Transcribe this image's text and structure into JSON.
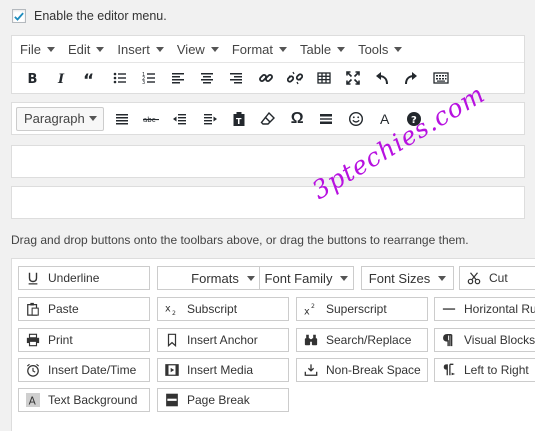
{
  "settings": {
    "enable_menu_label": "Enable the editor menu.",
    "enable_menu_checked": true
  },
  "menubar": {
    "items": [
      "File",
      "Edit",
      "Insert",
      "View",
      "Format",
      "Table",
      "Tools"
    ]
  },
  "toolbar1": {
    "icons": [
      "bold-icon",
      "italic-icon",
      "blockquote-icon",
      "bulleted-list-icon",
      "numbered-list-icon",
      "align-left-icon",
      "align-center-icon",
      "align-right-icon",
      "link-icon",
      "unlink-icon",
      "table-icon",
      "fullscreen-icon",
      "undo-icon",
      "redo-icon",
      "toolbar-toggle-icon"
    ]
  },
  "toolbar2": {
    "format_select": "Paragraph",
    "icons": [
      "justify-icon",
      "strikethrough-icon",
      "outdent-icon",
      "indent-icon",
      "paste-as-text-icon",
      "clear-formatting-icon",
      "special-character-icon",
      "horizontal-line-icon",
      "emoticons-icon",
      "text-color-icon",
      "help-icon"
    ],
    "text_color_glyph": "A",
    "special_char_glyph": "Ω"
  },
  "instructions": "Drag and drop buttons onto the toolbars above, or drag the buttons to rearrange them.",
  "watermark": "3ptechies.com",
  "available_buttons": {
    "underline": "Underline",
    "formats": "Formats",
    "font_family": "Font Family",
    "font_sizes": "Font Sizes",
    "cut": "Cut",
    "paste": "Paste",
    "subscript": "Subscript",
    "superscript": "Superscript",
    "horizontal_rule": "Horizontal Rule",
    "print": "Print",
    "insert_anchor": "Insert Anchor",
    "search_replace": "Search/Replace",
    "visual_blocks": "Visual Blocks",
    "insert_datetime": "Insert Date/Time",
    "insert_media": "Insert Media",
    "nonbreak_space": "Non-Break Space",
    "left_to_right": "Left to Right",
    "text_background": "Text Background",
    "page_break": "Page Break"
  },
  "colors": {
    "accent": "#1e8cbe",
    "watermark": "#b711e0",
    "background": "#f1f1f1"
  }
}
